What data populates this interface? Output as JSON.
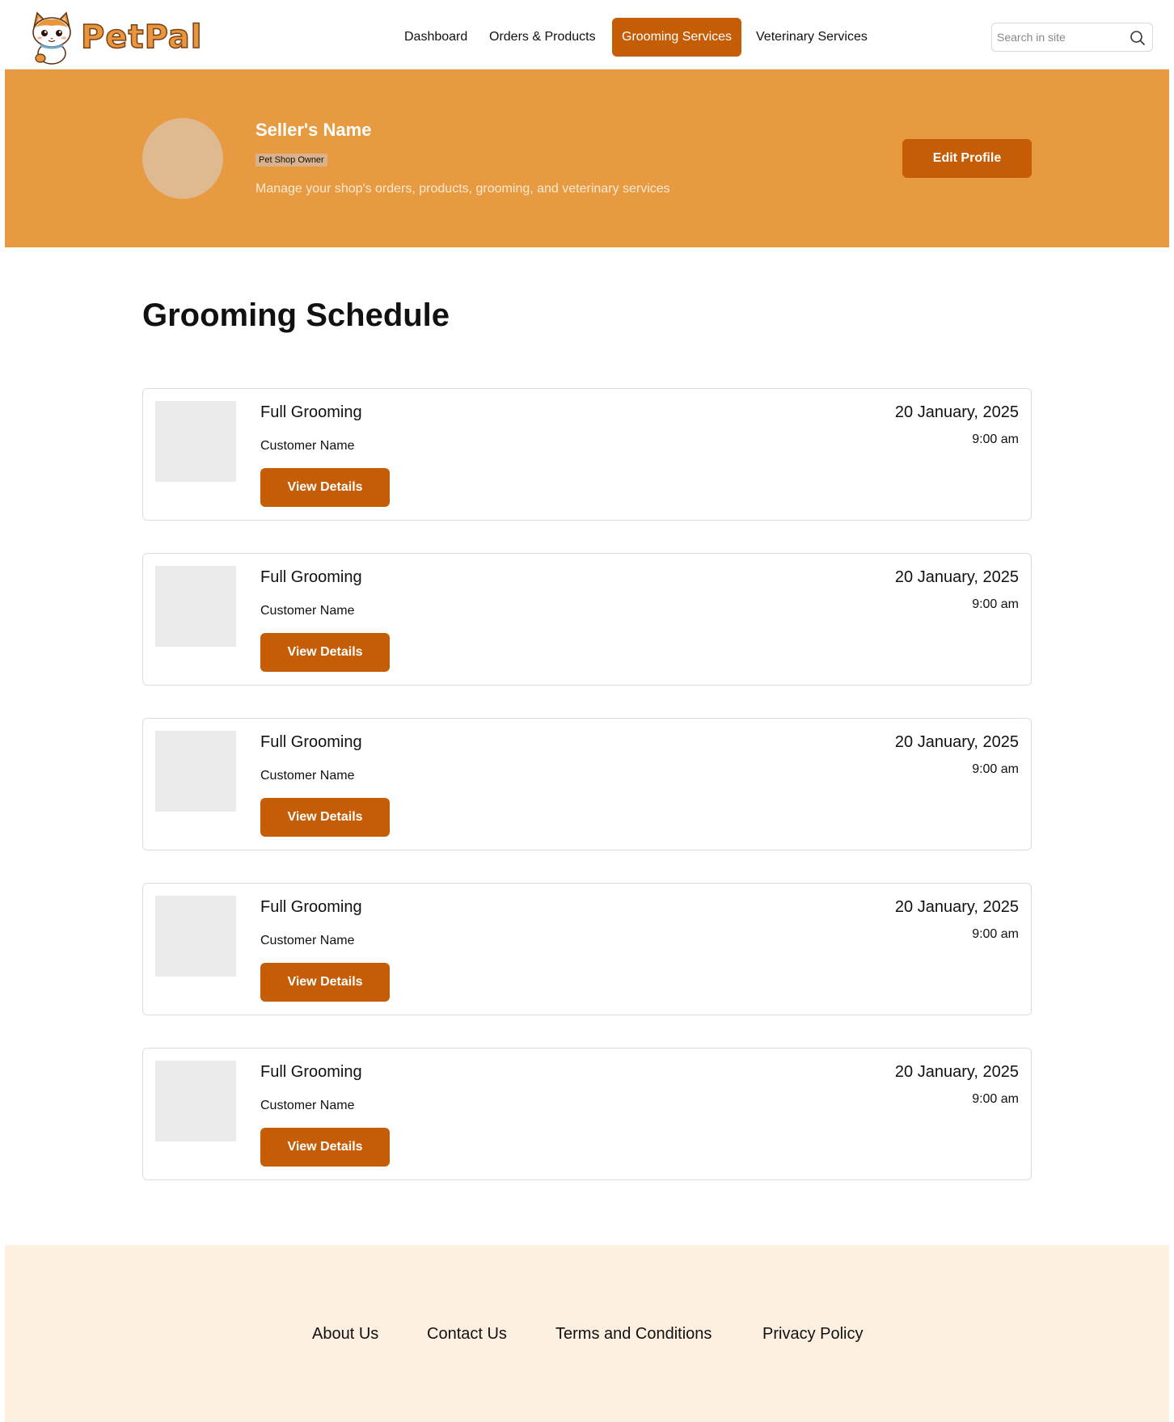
{
  "header": {
    "logo_text": "PetPal",
    "nav": [
      {
        "label": "Dashboard",
        "active": false
      },
      {
        "label": "Orders & Products",
        "active": false
      },
      {
        "label": "Grooming Services",
        "active": true
      },
      {
        "label": "Veterinary Services",
        "active": false
      }
    ],
    "search": {
      "placeholder": "Search in site",
      "icon": "search-icon"
    }
  },
  "hero": {
    "seller_name": "Seller's Name",
    "role_badge": "Pet Shop Owner",
    "description": "Manage your shop's orders, products, grooming, and veterinary services",
    "edit_button": "Edit Profile"
  },
  "main": {
    "title": "Grooming Schedule",
    "appointments": [
      {
        "service": "Full Grooming",
        "customer": "Customer Name",
        "date": "20 January, 2025",
        "time": "9:00 am",
        "button": "View Details"
      },
      {
        "service": "Full Grooming",
        "customer": "Customer Name",
        "date": "20 January, 2025",
        "time": "9:00 am",
        "button": "View Details"
      },
      {
        "service": "Full Grooming",
        "customer": "Customer Name",
        "date": "20 January, 2025",
        "time": "9:00 am",
        "button": "View Details"
      },
      {
        "service": "Full Grooming",
        "customer": "Customer Name",
        "date": "20 January, 2025",
        "time": "9:00 am",
        "button": "View Details"
      },
      {
        "service": "Full Grooming",
        "customer": "Customer Name",
        "date": "20 January, 2025",
        "time": "9:00 am",
        "button": "View Details"
      }
    ]
  },
  "footer": {
    "links": [
      "About Us",
      "Contact Us",
      "Terms and Conditions",
      "Privacy Policy"
    ]
  },
  "colors": {
    "accent": "#c55c06",
    "hero_bg": "#e79a3f",
    "footer_bg": "#fdf0e0",
    "avatar": "#dfb98f",
    "thumb_placeholder": "#ebebeb"
  }
}
